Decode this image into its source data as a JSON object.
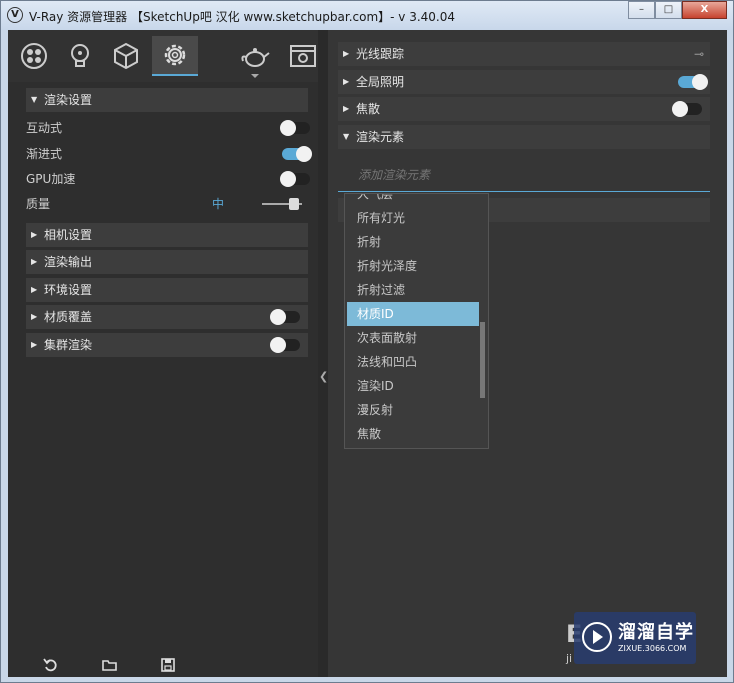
{
  "window": {
    "icon": "V",
    "title": "V-Ray 资源管理器 【SketchUp吧 汉化 www.sketchupbar.com】- v 3.40.04",
    "minimize_label": "–",
    "maximize_label": "□",
    "close_label": "X"
  },
  "toolbar": {
    "items": [
      {
        "icon": "material-sphere-icon"
      },
      {
        "icon": "light-bulb-icon"
      },
      {
        "icon": "geometry-cube-icon"
      },
      {
        "icon": "settings-gear-icon",
        "active": true
      },
      {
        "icon": "teapot-render-icon"
      },
      {
        "icon": "frame-buffer-icon"
      }
    ]
  },
  "render_settings": {
    "title": "渲染设置",
    "interactive_label": "互动式",
    "interactive_on": false,
    "progressive_label": "渐进式",
    "progressive_on": true,
    "gpu_label": "GPU加速",
    "gpu_on": false,
    "quality_label": "质量",
    "quality_value": "中"
  },
  "left_sections": {
    "camera": "相机设置",
    "render_output": "渲染输出",
    "environment": "环境设置",
    "material_override": "材质覆盖",
    "material_override_on": false,
    "swarm": "集群渲染",
    "swarm_on": false
  },
  "right_sections": {
    "raytrace": "光线跟踪",
    "gi": "全局照明",
    "gi_on": true,
    "caustics": "焦散",
    "caustics_on": false,
    "render_elements": "渲染元素",
    "add_placeholder": "添加渲染元素"
  },
  "dropdown": {
    "items": [
      "大气层",
      "所有灯光",
      "折射",
      "折射光泽度",
      "折射过滤",
      "材质ID",
      "次表面散射",
      "法线和凹凸",
      "渲染ID",
      "漫反射",
      "焦散"
    ],
    "selected_index": 5
  },
  "watermark": {
    "text": "溜溜自学",
    "sub": "ZIXUE.3066.COM",
    "bg_letters": "E",
    "bg_letters2": "ji"
  },
  "colors": {
    "accent": "#5aa9d6",
    "selected": "#7dbad8",
    "panel": "#2e2e2e"
  }
}
